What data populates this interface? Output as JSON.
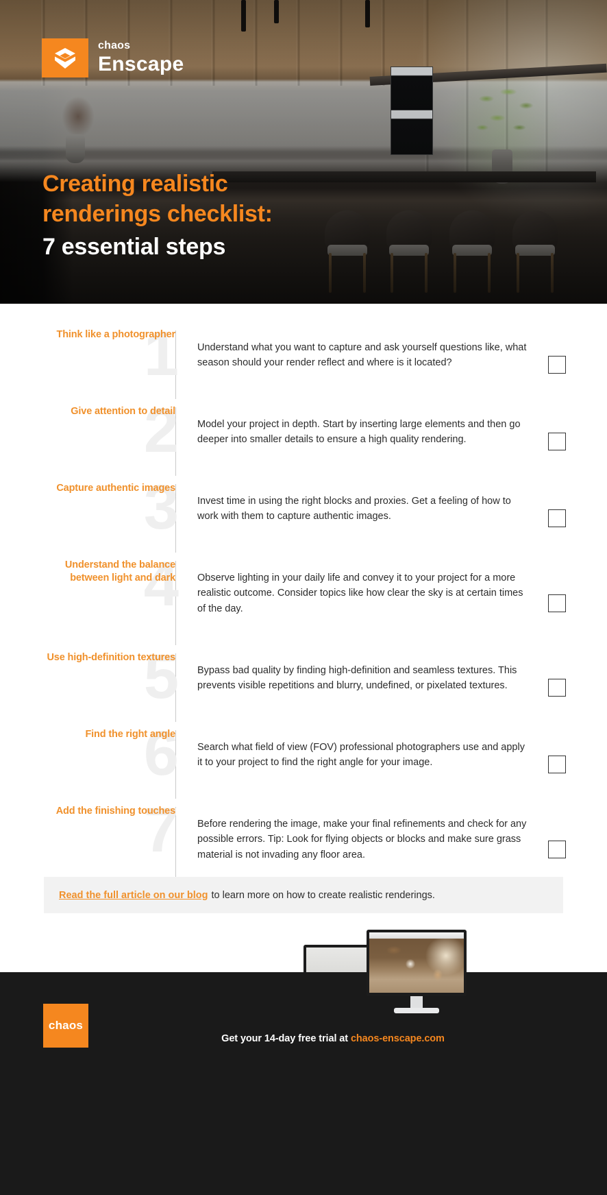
{
  "brand": {
    "accent_orange": "#F5871F",
    "heading_orange": "#F0912C",
    "ghost_number_gray": "#EFEFEF",
    "footer_dark": "#1A1A1A",
    "cta_bg": "#F2F2F2"
  },
  "hero": {
    "logo_mark_name": "enscape-chevron-logo-icon",
    "logo_chaos": "chaos",
    "logo_enscape": "Enscape",
    "title_line1": "Creating realistic",
    "title_line2": "renderings checklist:",
    "title_line3": "7 essential steps"
  },
  "checklist": {
    "items": [
      {
        "number": "1",
        "heading": "Think like a photographer",
        "body": "Understand what you want to capture and ask yourself questions like, what season should your render reflect and where is it located?",
        "checked": false
      },
      {
        "number": "2",
        "heading": "Give attention to detail",
        "body": "Model your project in depth. Start by inserting large elements and then go deeper into smaller details to ensure a high quality rendering.",
        "checked": false
      },
      {
        "number": "3",
        "heading": "Capture authentic images",
        "body": "Invest time in using the right blocks and proxies. Get a feeling of how to work with them to capture authentic images.",
        "checked": false
      },
      {
        "number": "4",
        "heading": "Understand the balance between light and dark",
        "body": "Observe lighting in your daily life and convey it to your project for a more realistic outcome. Consider topics like how clear the sky is at certain times of the day.",
        "checked": false
      },
      {
        "number": "5",
        "heading": "Use high-definition textures",
        "body": "Bypass bad quality by finding high-definition and seamless textures. This prevents visible repetitions and blurry, undefined, or pixelated textures.",
        "checked": false
      },
      {
        "number": "6",
        "heading": "Find the right angle",
        "body": "Search what field of view (FOV) professional photographers use and apply it to your project to find the right angle for your image.",
        "checked": false
      },
      {
        "number": "7",
        "heading": "Add the finishing touches",
        "body": "Before rendering the image, make your final refinements and check for any possible errors. Tip: Look for flying objects or blocks and make sure grass material is not invading any floor area.",
        "checked": false
      }
    ]
  },
  "cta": {
    "link_text": "Read the full article on our blog",
    "rest_text": "to learn more on how to create realistic renderings."
  },
  "footer": {
    "chaos_logo": "chaos",
    "trial_prefix": "Get your 14-day free trial at ",
    "trial_url": "chaos-enscape.com"
  }
}
